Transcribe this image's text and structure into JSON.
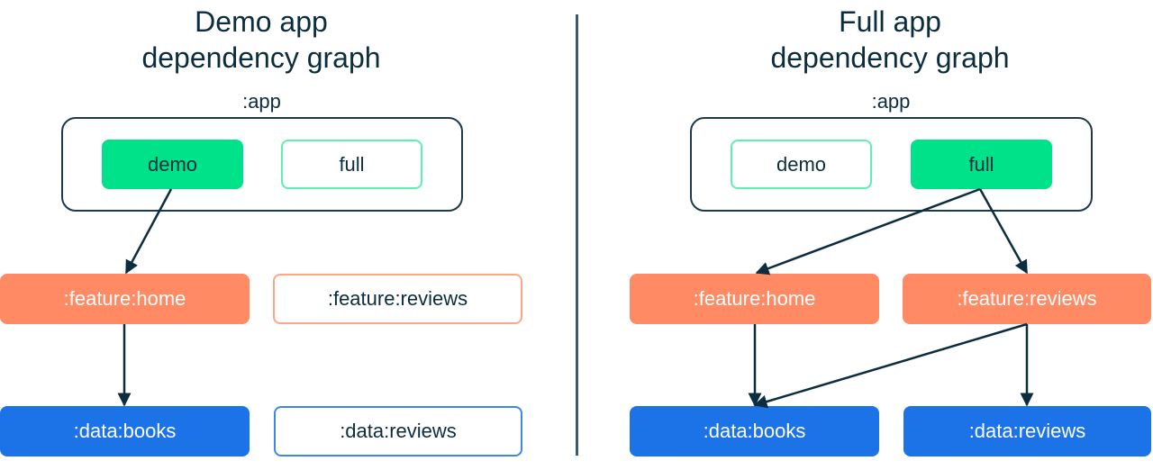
{
  "panels": [
    {
      "title_line1": "Demo app",
      "title_line2": "dependency graph",
      "app_label": ":app",
      "flavors": {
        "demo": "demo",
        "full": "full"
      },
      "active_flavor": "demo",
      "modules": {
        "feature_home": ":feature:home",
        "feature_reviews": ":feature:reviews",
        "data_books": ":data:books",
        "data_reviews": ":data:reviews"
      },
      "edges": [
        [
          "demo",
          "feature_home"
        ],
        [
          "feature_home",
          "data_books"
        ]
      ]
    },
    {
      "title_line1": "Full app",
      "title_line2": "dependency graph",
      "app_label": ":app",
      "flavors": {
        "demo": "demo",
        "full": "full"
      },
      "active_flavor": "full",
      "modules": {
        "feature_home": ":feature:home",
        "feature_reviews": ":feature:reviews",
        "data_books": ":data:books",
        "data_reviews": ":data:reviews"
      },
      "edges": [
        [
          "full",
          "feature_home"
        ],
        [
          "full",
          "feature_reviews"
        ],
        [
          "feature_home",
          "data_books"
        ],
        [
          "feature_reviews",
          "data_books"
        ],
        [
          "feature_reviews",
          "data_reviews"
        ]
      ]
    }
  ],
  "colors": {
    "text": "#0b2d3d",
    "flavor": "#00e28a",
    "feature": "#ff8a64",
    "data": "#1c73e8",
    "edge": "#0b2d3d"
  }
}
